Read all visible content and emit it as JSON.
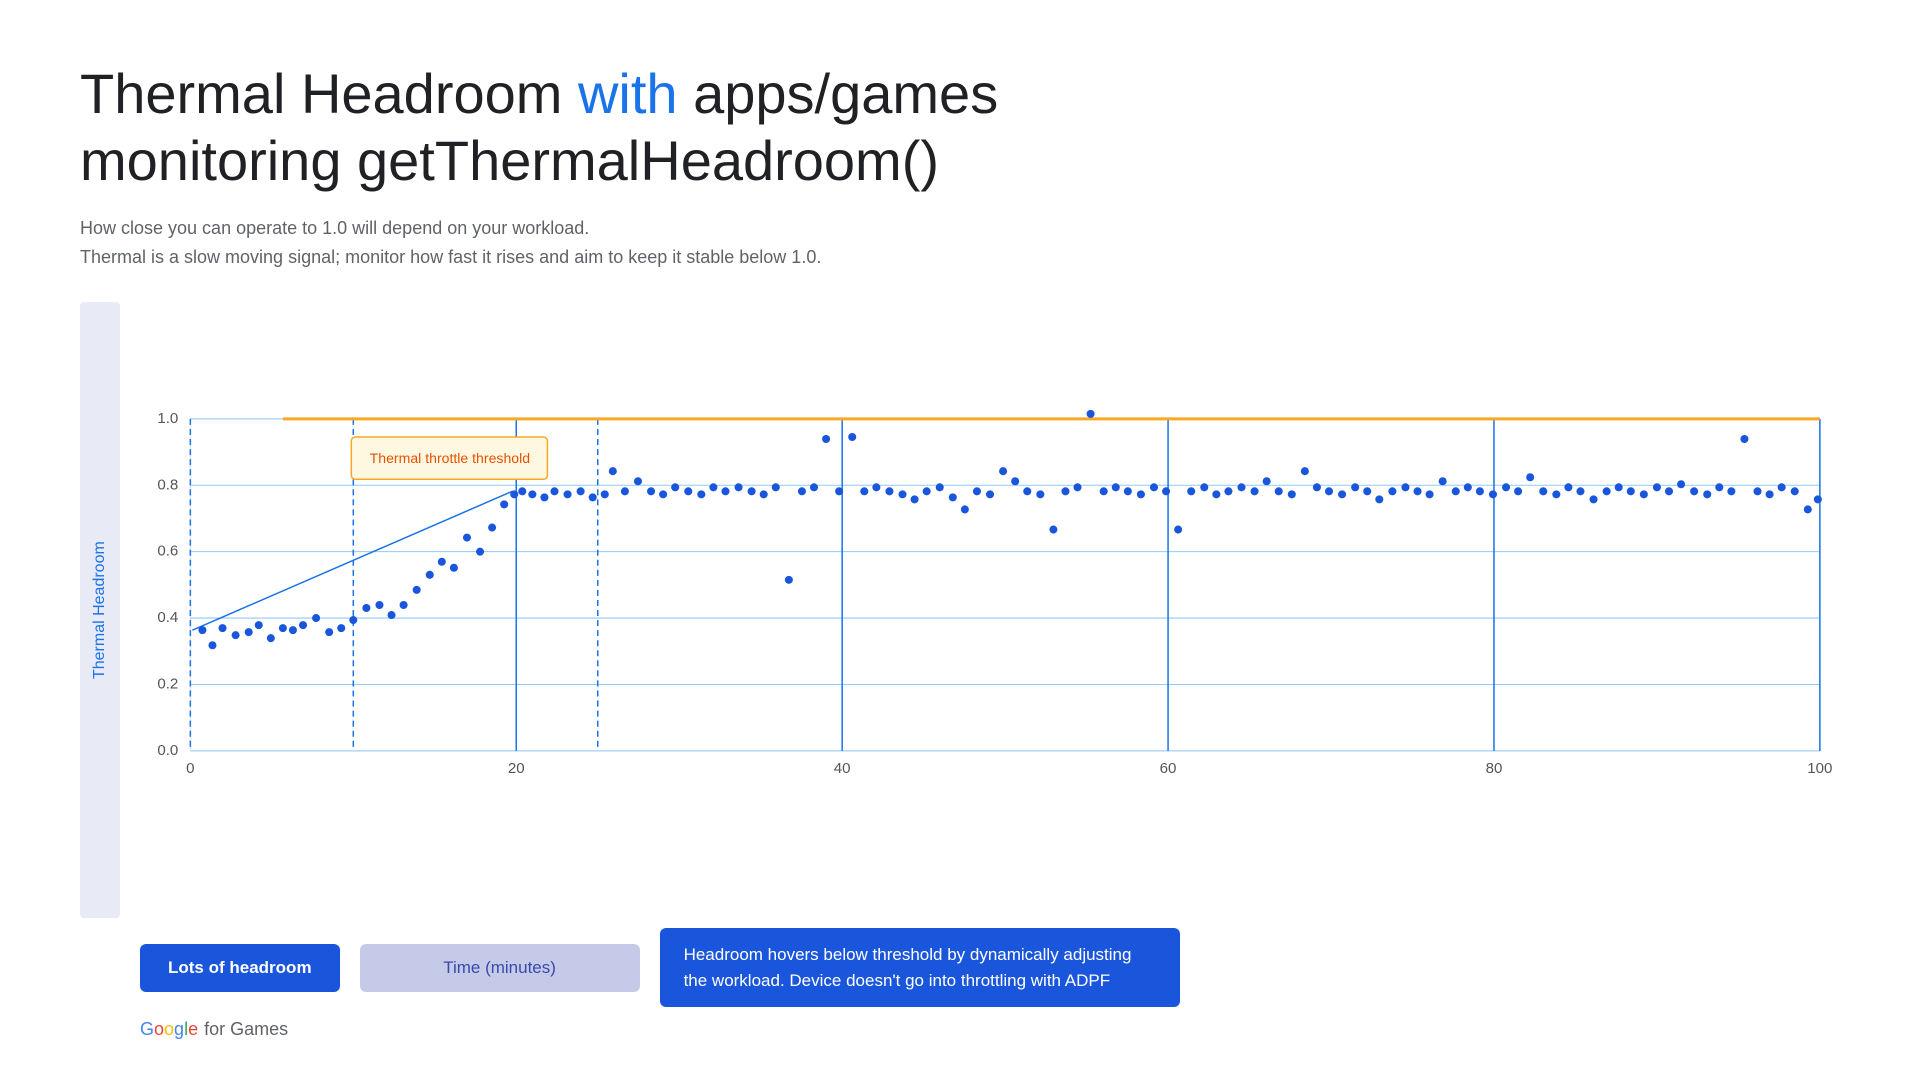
{
  "title": {
    "part1": "Thermal Headroom ",
    "highlight": "with",
    "part2": " apps/games",
    "line2": "monitoring getThermalHeadroom()"
  },
  "subtitle": {
    "line1": "How close you can operate to 1.0 will depend on your workload.",
    "line2": "Thermal is a slow moving signal; monitor how fast it rises and aim to keep it stable below 1.0."
  },
  "chart": {
    "y_axis_label": "Thermal Headroom",
    "x_axis_label": "Time (minutes)",
    "y_ticks": [
      "0.0",
      "0.2",
      "0.4",
      "0.6",
      "0.8",
      "1.0"
    ],
    "x_ticks": [
      "0",
      "20",
      "40",
      "60",
      "80",
      "100"
    ],
    "threshold_label": "Thermal throttle threshold",
    "threshold_value": 1.0
  },
  "labels": {
    "lots_headroom": "Lots of headroom",
    "time_minutes": "Time (minutes)",
    "headroom_desc": "Headroom hovers below threshold by dynamically adjusting the workload. Device doesn't go into throttling with ADPF"
  },
  "google_logo": {
    "google": "Google",
    "for_games": " for Games"
  },
  "colors": {
    "blue": "#1a73e8",
    "gold": "#f9a825",
    "dot_blue": "#1a56db",
    "grid_blue": "#90caf9",
    "dashed_line": "#1a73e8"
  }
}
